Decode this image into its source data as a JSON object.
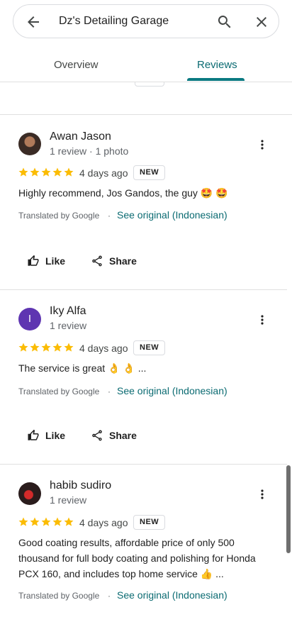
{
  "search": {
    "query": "Dz's Detailing Garage"
  },
  "tabs": [
    {
      "label": "Overview"
    },
    {
      "label": "Reviews"
    }
  ],
  "colors": {
    "accent": "#0b7a82",
    "star": "#fbbc04"
  },
  "reviews": [
    {
      "name": "Awan Jason",
      "meta": "1 review · 1 photo",
      "rating": 5,
      "time": "4 days ago",
      "badge": "NEW",
      "text": "Highly recommend, Jos Gandos, the guy 🤩 🤩",
      "translated_by": "Translated by Google",
      "see_original": "See original (Indonesian)",
      "like": "Like",
      "share": "Share"
    },
    {
      "name": "Iky Alfa",
      "avatar_letter": "I",
      "meta": "1 review",
      "rating": 5,
      "time": "4 days ago",
      "badge": "NEW",
      "text": "The service is great 👌 👌 ...",
      "translated_by": "Translated by Google",
      "see_original": "See original (Indonesian)",
      "like": "Like",
      "share": "Share"
    },
    {
      "name": "habib sudiro",
      "meta": "1 review",
      "rating": 5,
      "time": "4 days ago",
      "badge": "NEW",
      "text": "Good coating results, affordable price of only 500 thousand for full body coating and polishing for Honda PCX 160, and includes top home service 👍 ...",
      "translated_by": "Translated by Google",
      "see_original": "See original (Indonesian)"
    }
  ]
}
